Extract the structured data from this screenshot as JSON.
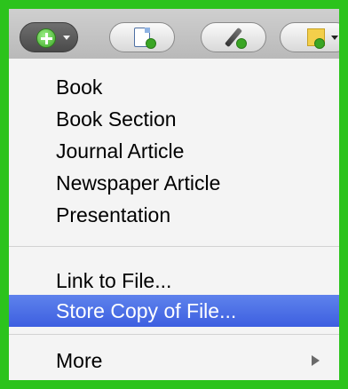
{
  "toolbar": {
    "buttons": [
      {
        "name": "new-item-button",
        "icon": "plus-circle-icon",
        "has_dropdown": true,
        "active": true
      },
      {
        "name": "new-item-from-file-button",
        "icon": "document-add-icon",
        "has_dropdown": false,
        "active": false
      },
      {
        "name": "add-attachment-button",
        "icon": "pen-add-icon",
        "has_dropdown": false,
        "active": false
      },
      {
        "name": "new-note-button",
        "icon": "note-add-icon",
        "has_dropdown": true,
        "active": false
      }
    ]
  },
  "menu": {
    "groups": [
      {
        "items": [
          "Book",
          "Book Section",
          "Journal Article",
          "Newspaper Article",
          "Presentation"
        ]
      },
      {
        "items": [
          "Link to File...",
          "Store Copy of File..."
        ],
        "selected": "Store Copy of File..."
      },
      {
        "items": [
          "More"
        ],
        "has_submenu": true
      }
    ]
  },
  "colors": {
    "border": "#2cc31c",
    "selection": "#3d5fe0",
    "menu_background": "#f4f4f4"
  }
}
